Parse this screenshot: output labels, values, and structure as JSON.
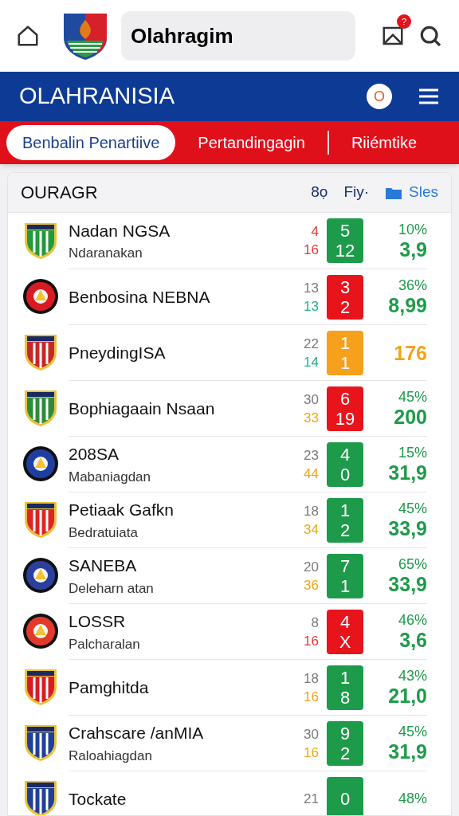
{
  "header": {
    "title": "Olahragim",
    "badge": "?"
  },
  "banner": {
    "title": "OLAHRANISIA",
    "circle_label": "O"
  },
  "tabs": [
    {
      "label": "Benbalin Penartiive",
      "selected": true
    },
    {
      "label": "Pertandingagin",
      "selected": false
    },
    {
      "label": "Riiémtike",
      "selected": false
    }
  ],
  "card": {
    "title": "OURAGR",
    "col_1": "8ọ",
    "col_2": "Fiy·",
    "col_3": "Sles"
  },
  "rows": [
    {
      "name": "Nadan NGSA",
      "sub": "Ndaranakan",
      "crest": {
        "kind": "shield",
        "color": "#1f9a3c"
      },
      "top": {
        "text": "4",
        "color": "#e53935"
      },
      "bottom": {
        "text": "16",
        "color": "#e53935"
      },
      "score": {
        "lines": [
          "5",
          "12"
        ],
        "color": "#1e9b4a"
      },
      "pct": "10%",
      "value": {
        "text": "3,9",
        "color": "#1e9b4a"
      }
    },
    {
      "name": "Benbosina NEBNA",
      "crest": {
        "kind": "circle",
        "color": "#d81b22"
      },
      "top": {
        "text": "13",
        "color": "#7a7a7a"
      },
      "bottom": {
        "text": "13",
        "color": "#26b08a"
      },
      "score": {
        "lines": [
          "3",
          "2"
        ],
        "color": "#e8141c"
      },
      "pct": "36%",
      "value": {
        "text": "8,99",
        "color": "#1e9b4a"
      }
    },
    {
      "name": "PneydingISA",
      "crest": {
        "kind": "shield",
        "color": "#c62828"
      },
      "top": {
        "text": "22",
        "color": "#7a7a7a"
      },
      "bottom": {
        "text": "14",
        "color": "#26b08a"
      },
      "score": {
        "lines": [
          "1",
          "1"
        ],
        "color": "#f7a01c"
      },
      "value": {
        "text": "176",
        "color": "#f0a51c"
      }
    },
    {
      "name": "Bophiagaain Nsaan",
      "crest": {
        "kind": "shield",
        "color": "#2e8b3a"
      },
      "top": {
        "text": "30",
        "color": "#7a7a7a"
      },
      "bottom": {
        "text": "33",
        "color": "#f0a51c"
      },
      "score": {
        "lines": [
          "6",
          "19"
        ],
        "color": "#e8141c"
      },
      "pct": "45%",
      "value": {
        "text": "200",
        "color": "#1e9b4a"
      }
    },
    {
      "name": "208SA",
      "sub": "Mabaniagdan",
      "crest": {
        "kind": "circle",
        "color": "#1f3fa0"
      },
      "top": {
        "text": "23",
        "color": "#7a7a7a"
      },
      "bottom": {
        "text": "44",
        "color": "#f0a51c"
      },
      "score": {
        "lines": [
          "4",
          "0"
        ],
        "color": "#1e9b4a"
      },
      "pct": "15%",
      "value": {
        "text": "31,9",
        "color": "#1e9b4a"
      }
    },
    {
      "name": "Petiaak Gafkn",
      "sub": "Bedratuiata",
      "crest": {
        "kind": "shield",
        "color": "#e02424"
      },
      "top": {
        "text": "18",
        "color": "#7a7a7a"
      },
      "bottom": {
        "text": "34",
        "color": "#f0a51c"
      },
      "score": {
        "lines": [
          "1",
          "2"
        ],
        "color": "#1e9b4a"
      },
      "pct": "45%",
      "value": {
        "text": "33,9",
        "color": "#1e9b4a"
      }
    },
    {
      "name": "SANEBA",
      "sub": "Deleharn atan",
      "crest": {
        "kind": "circle",
        "color": "#2b3f9e"
      },
      "top": {
        "text": "20",
        "color": "#7a7a7a"
      },
      "bottom": {
        "text": "36",
        "color": "#f0a51c"
      },
      "score": {
        "lines": [
          "7",
          "1"
        ],
        "color": "#1e9b4a"
      },
      "pct": "65%",
      "value": {
        "text": "33,9",
        "color": "#1e9b4a"
      }
    },
    {
      "name": "LOSSR",
      "sub": "Palcharalan",
      "crest": {
        "kind": "circle",
        "color": "#e23a2a"
      },
      "top": {
        "text": "8",
        "color": "#7a7a7a"
      },
      "bottom": {
        "text": "16",
        "color": "#e53935"
      },
      "score": {
        "lines": [
          "4",
          "X"
        ],
        "color": "#e8141c"
      },
      "pct": "46%",
      "value": {
        "text": "3,6",
        "color": "#1e9b4a"
      }
    },
    {
      "name": "Pamghitda",
      "crest": {
        "kind": "shield",
        "color": "#d91c24"
      },
      "top": {
        "text": "18",
        "color": "#7a7a7a"
      },
      "bottom": {
        "text": "16",
        "color": "#f0a51c"
      },
      "score": {
        "lines": [
          "1",
          "8"
        ],
        "color": "#1e9b4a"
      },
      "pct": "43%",
      "value": {
        "text": "21,0",
        "color": "#1e9b4a"
      }
    },
    {
      "name": "Crahscare /anMIA",
      "sub": "Raloahiagdan",
      "crest": {
        "kind": "shield",
        "color": "#1f3f9a"
      },
      "top": {
        "text": "30",
        "color": "#7a7a7a"
      },
      "bottom": {
        "text": "16",
        "color": "#f0a51c"
      },
      "score": {
        "lines": [
          "9",
          "2"
        ],
        "color": "#1e9b4a"
      },
      "pct": "45%",
      "value": {
        "text": "31,9",
        "color": "#1e9b4a"
      }
    },
    {
      "name": "Tockate",
      "crest": {
        "kind": "shield",
        "color": "#1f3f9a"
      },
      "top": {
        "text": "21",
        "color": "#7a7a7a"
      },
      "score": {
        "lines": [
          "0"
        ],
        "color": "#1e9b4a"
      },
      "pct": "48%"
    }
  ]
}
